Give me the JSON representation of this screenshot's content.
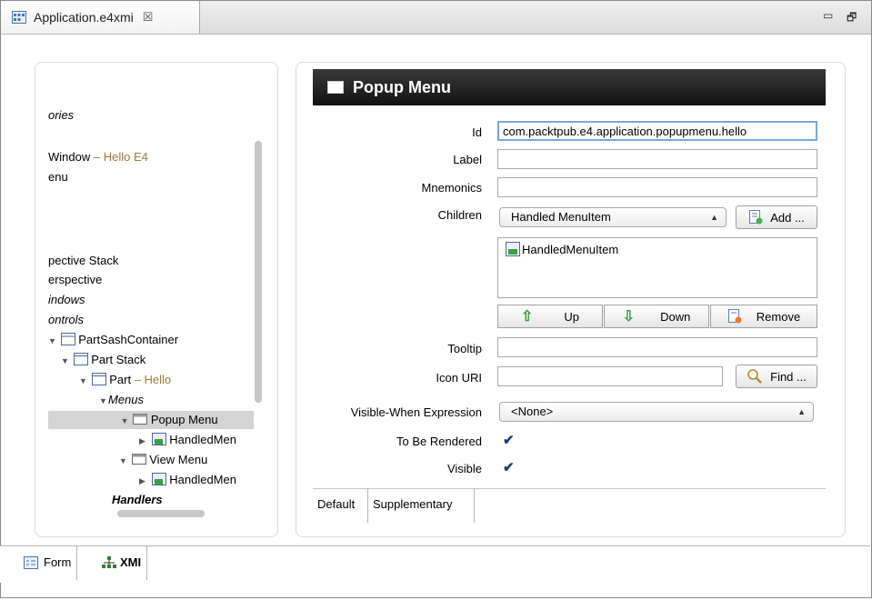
{
  "editor_tab": {
    "title": "Application.e4xmi",
    "close": "☒"
  },
  "window_controls": {
    "minimize": "▭",
    "restore": "🗗"
  },
  "tree": {
    "items": [
      {
        "text": "ories",
        "italic": true
      },
      {
        "text": "Window",
        "suffix": " – Hello E4"
      },
      {
        "text": "enu"
      },
      {
        "text": "pective Stack"
      },
      {
        "text": "erspective"
      },
      {
        "text": "indows",
        "italic": true
      },
      {
        "text": "ontrols",
        "italic": true
      },
      {
        "text": "PartSashContainer"
      },
      {
        "text": "Part Stack"
      },
      {
        "text": "Part",
        "suffix": " – Hello"
      },
      {
        "text": "Menus",
        "italic": true
      },
      {
        "text": "Popup Menu",
        "selected": true
      },
      {
        "text": "HandledMen"
      },
      {
        "text": "View Menu"
      },
      {
        "text": "HandledMen"
      },
      {
        "text": "Handlers",
        "italic": true
      }
    ]
  },
  "form": {
    "title": "Popup Menu",
    "id_label": "Id",
    "id_value": "com.packtpub.e4.application.popupmenu.hello",
    "label_label": "Label",
    "label_value": "",
    "mnemonics_label": "Mnemonics",
    "mnemonics_value": "",
    "children_label": "Children",
    "children_combo": "Handled MenuItem",
    "add_button": "Add ...",
    "children_list": [
      "HandledMenuItem"
    ],
    "up_button": "Up",
    "down_button": "Down",
    "remove_button": "Remove",
    "tooltip_label": "Tooltip",
    "tooltip_value": "",
    "icon_uri_label": "Icon URI",
    "icon_uri_value": "",
    "find_button": "Find ...",
    "visible_when_label": "Visible-When Expression",
    "visible_when_value": "<None>",
    "to_be_rendered_label": "To Be Rendered",
    "to_be_rendered_checked": true,
    "visible_label": "Visible",
    "visible_checked": true,
    "subtabs": [
      "Default",
      "Supplementary"
    ]
  },
  "bottom_tabs": [
    "Form",
    "XMI"
  ],
  "colors": {
    "header_bg": "#1a1a1a",
    "highlight_text": "#9b7b3b",
    "selection": "#d4d4d4"
  }
}
